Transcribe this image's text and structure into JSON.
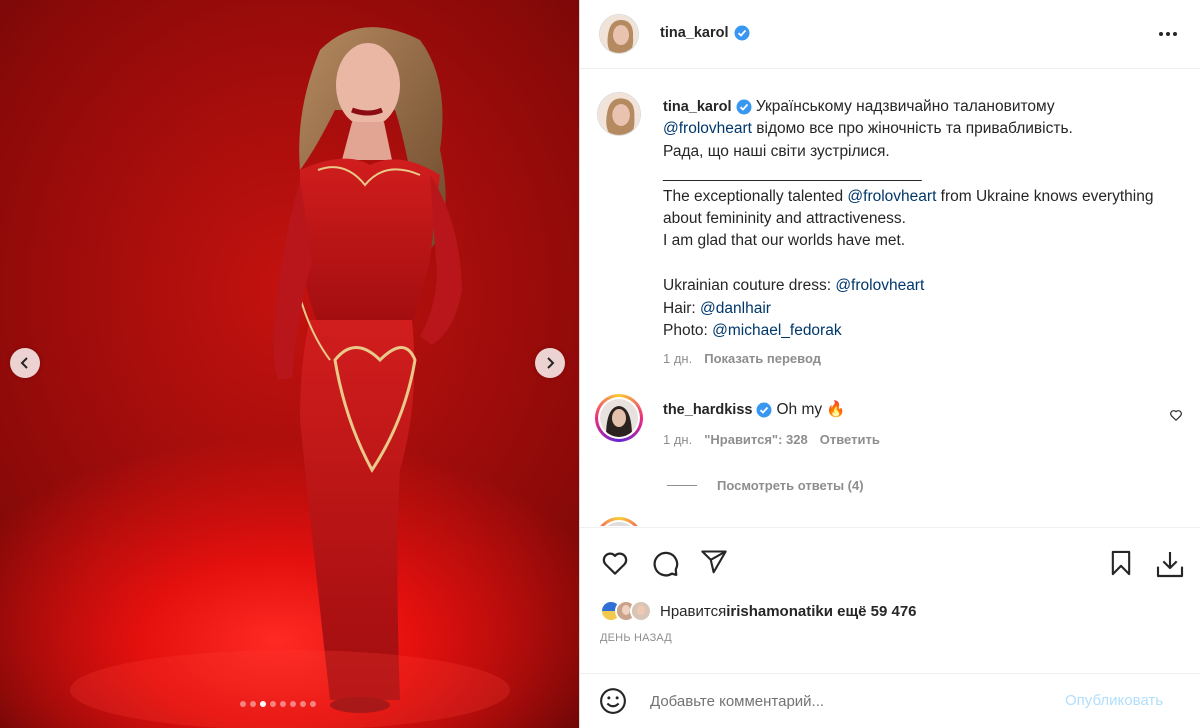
{
  "media": {
    "dots_count": 8,
    "active_dot": 3,
    "colors": {
      "background": "#c4120f",
      "dress": "#c8191a",
      "accent_gold": "#e8c98a"
    }
  },
  "header": {
    "username": "tina_karol",
    "verified": true,
    "more_icon": "more-horizontal-icon"
  },
  "caption": {
    "username": "tina_karol",
    "text_ua_1": "Українському надзвичайно талановитому",
    "mention_1": "@frolovheart",
    "text_ua_2": " відомо все про жіночність та привабливість.",
    "text_ua_3": "Рада, що наші світи зустрілися.",
    "separator": "______________________________",
    "text_en_1": "The exceptionally talented ",
    "mention_2": "@frolovheart",
    "text_en_2": " from Ukraine knows everything about femininity and attractiveness.",
    "text_en_3": "I am glad that our worlds have met.",
    "dress_label": "Ukrainian couture dress: ",
    "mention_3": "@frolovheart",
    "hair_label": "Hair: ",
    "mention_4": "@danlhair",
    "photo_label": "Photo: ",
    "mention_5": "@michael_fedorak",
    "time": "1 дн.",
    "translate": "Показать перевод"
  },
  "comments": [
    {
      "username": "the_hardkiss",
      "verified": true,
      "text": "Oh my",
      "emoji": "🔥",
      "time": "1 дн.",
      "likes": "\"Нравится\": 328",
      "reply": "Ответить",
      "view_replies": "Посмотреть ответы (4)"
    }
  ],
  "actions": {
    "like_icon": "heart-icon",
    "comment_icon": "comment-icon",
    "share_icon": "paper-plane-icon",
    "save_icon": "bookmark-icon",
    "download_icon": "download-icon"
  },
  "likes": {
    "prefix": "Нравится ",
    "user": "irishamonatik",
    "suffix": " и ещё 59 476"
  },
  "timeago": "ДЕНЬ НАЗАД",
  "add_comment": {
    "placeholder": "Добавьте комментарий...",
    "post_label": "Опубликовать",
    "post_color": "#b2dffc"
  },
  "accent": {
    "verified": "#3897f0",
    "link": "#00376b",
    "muted": "#8e8e8e"
  }
}
